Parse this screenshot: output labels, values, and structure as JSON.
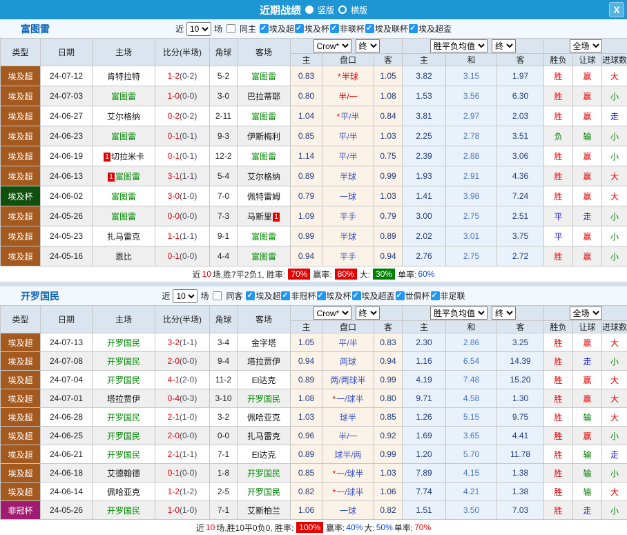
{
  "titlebar": {
    "title": "近期战绩",
    "vertical": "竖版",
    "horizontal": "横版",
    "close": "X"
  },
  "badges": {
    "red_card": "1"
  },
  "table_header": {
    "cols": [
      "类型",
      "日期",
      "主场",
      "比分(半场)",
      "角球",
      "客场"
    ],
    "sub": [
      "主",
      "盘口",
      "客",
      "主",
      "和",
      "客",
      "胜负",
      "让球",
      "进球数"
    ],
    "odds_source": "Crow*",
    "final": "终",
    "avg_label": "胜平负均值",
    "scope": "全场"
  },
  "colors": {
    "accent_blue": "#1E96D4",
    "league_super": "#A4591F",
    "league_cup": "#10500E",
    "league_afc": "#A21B72",
    "red": "#E60000",
    "green": "#008000",
    "blue": "#1414E6",
    "navy": "#1F3A7D",
    "mid_blue": "#4876CB"
  },
  "sections": [
    {
      "team": "富图雷",
      "filter": {
        "near": "近",
        "count": "10",
        "games": "场",
        "same_label": "同主",
        "same_checked": false,
        "leagues": [
          "埃及超",
          "埃及杯",
          "非联杯",
          "埃及联杯",
          "埃及超盃"
        ]
      },
      "rows": [
        {
          "type": "埃及超",
          "tc": "super",
          "date": "24-07-12",
          "home": {
            "n": "肯特拉特",
            "g": 0
          },
          "ft": "1-2",
          "ht": "(0-2)",
          "cr": "5-2",
          "away": {
            "n": "富图雷",
            "g": 1
          },
          "oh": "0.83",
          "hast": 1,
          "hcp": "半球",
          "hred": 1,
          "oa": "1.05",
          "ah": "3.82",
          "ad": "3.15",
          "aa": "1.97",
          "r1": [
            "胜",
            "r"
          ],
          "r2": [
            "赢",
            "r"
          ],
          "r3": [
            "大",
            "r"
          ]
        },
        {
          "type": "埃及超",
          "tc": "super",
          "date": "24-07-03",
          "home": {
            "n": "富图雷",
            "g": 1
          },
          "ft": "1-0",
          "ht": "(0-0)",
          "cr": "3-0",
          "away": {
            "n": "巴拉蒂耶",
            "g": 0
          },
          "oh": "0.80",
          "hast": 0,
          "hcp": "半/一",
          "hred": 1,
          "oa": "1.08",
          "ah": "1.53",
          "ad": "3.56",
          "aa": "6.30",
          "r1": [
            "胜",
            "r"
          ],
          "r2": [
            "赢",
            "r"
          ],
          "r3": [
            "小",
            "g"
          ]
        },
        {
          "type": "埃及超",
          "tc": "super",
          "date": "24-06-27",
          "home": {
            "n": "艾尔格纳",
            "g": 0
          },
          "ft": "0-2",
          "ht": "(0-2)",
          "cr": "2-11",
          "away": {
            "n": "富图雷",
            "g": 1
          },
          "oh": "1.04",
          "hast": 1,
          "hcp": "平/半",
          "hred": 0,
          "oa": "0.84",
          "ah": "3.81",
          "ad": "2.97",
          "aa": "2.03",
          "r1": [
            "胜",
            "r"
          ],
          "r2": [
            "赢",
            "r"
          ],
          "r3": [
            "走",
            "b"
          ]
        },
        {
          "type": "埃及超",
          "tc": "super",
          "date": "24-06-23",
          "home": {
            "n": "富图雷",
            "g": 1
          },
          "ft": "0-1",
          "ht": "(0-1)",
          "cr": "9-3",
          "away": {
            "n": "伊斯梅利",
            "g": 0
          },
          "oh": "0.85",
          "hast": 0,
          "hcp": "平/半",
          "hred": 0,
          "oa": "1.03",
          "ah": "2.25",
          "ad": "2.78",
          "aa": "3.51",
          "r1": [
            "负",
            "g"
          ],
          "r2": [
            "输",
            "g"
          ],
          "r3": [
            "小",
            "g"
          ]
        },
        {
          "type": "埃及超",
          "tc": "super",
          "date": "24-06-19",
          "home": {
            "n": "切拉米卡",
            "g": 0,
            "rb": 1
          },
          "ft": "0-1",
          "ht": "(0-1)",
          "cr": "12-2",
          "away": {
            "n": "富图雷",
            "g": 1
          },
          "oh": "1.14",
          "hast": 0,
          "hcp": "平/半",
          "hred": 0,
          "oa": "0.75",
          "ah": "2.39",
          "ad": "2.88",
          "aa": "3.06",
          "r1": [
            "胜",
            "r"
          ],
          "r2": [
            "赢",
            "r"
          ],
          "r3": [
            "小",
            "g"
          ]
        },
        {
          "type": "埃及超",
          "tc": "super",
          "date": "24-06-13",
          "home": {
            "n": "富图雷",
            "g": 1,
            "rb": 1
          },
          "ft": "3-1",
          "ht": "(1-1)",
          "cr": "5-4",
          "away": {
            "n": "艾尔格纳",
            "g": 0
          },
          "oh": "0.89",
          "hast": 0,
          "hcp": "半球",
          "hred": 0,
          "oa": "0.99",
          "ah": "1.93",
          "ad": "2.91",
          "aa": "4.36",
          "r1": [
            "胜",
            "r"
          ],
          "r2": [
            "赢",
            "r"
          ],
          "r3": [
            "大",
            "r"
          ]
        },
        {
          "type": "埃及杯",
          "tc": "cup",
          "date": "24-06-02",
          "home": {
            "n": "富图雷",
            "g": 1
          },
          "ft": "3-0",
          "ht": "(1-0)",
          "cr": "7-0",
          "away": {
            "n": "佩特雷姆",
            "g": 0
          },
          "oh": "0.79",
          "hast": 0,
          "hcp": "一球",
          "hred": 0,
          "oa": "1.03",
          "ah": "1.41",
          "ad": "3.98",
          "aa": "7.24",
          "r1": [
            "胜",
            "r"
          ],
          "r2": [
            "赢",
            "r"
          ],
          "r3": [
            "大",
            "r"
          ]
        },
        {
          "type": "埃及超",
          "tc": "super",
          "date": "24-05-26",
          "home": {
            "n": "富图雷",
            "g": 1
          },
          "ft": "0-0",
          "ht": "(0-0)",
          "cr": "7-3",
          "away": {
            "n": "马斯里",
            "g": 0,
            "ra": 1
          },
          "oh": "1.09",
          "hast": 0,
          "hcp": "平手",
          "hred": 0,
          "oa": "0.79",
          "ah": "3.00",
          "ad": "2.75",
          "aa": "2.51",
          "r1": [
            "平",
            "b"
          ],
          "r2": [
            "走",
            "b"
          ],
          "r3": [
            "小",
            "g"
          ]
        },
        {
          "type": "埃及超",
          "tc": "super",
          "date": "24-05-23",
          "home": {
            "n": "扎马雷克",
            "g": 0
          },
          "ft": "1-1",
          "ht": "(1-1)",
          "cr": "9-1",
          "away": {
            "n": "富图雷",
            "g": 1
          },
          "oh": "0.99",
          "hast": 0,
          "hcp": "半球",
          "hred": 0,
          "oa": "0.89",
          "ah": "2.02",
          "ad": "3.01",
          "aa": "3.75",
          "r1": [
            "平",
            "b"
          ],
          "r2": [
            "赢",
            "r"
          ],
          "r3": [
            "小",
            "g"
          ]
        },
        {
          "type": "埃及超",
          "tc": "super",
          "date": "24-05-16",
          "home": {
            "n": "恩比",
            "g": 0
          },
          "ft": "0-1",
          "ht": "(0-0)",
          "cr": "4-4",
          "away": {
            "n": "富图雷",
            "g": 1
          },
          "oh": "0.94",
          "hast": 0,
          "hcp": "平手",
          "hred": 0,
          "oa": "0.94",
          "ah": "2.76",
          "ad": "2.75",
          "aa": "2.72",
          "r1": [
            "胜",
            "r"
          ],
          "r2": [
            "赢",
            "r"
          ],
          "r3": [
            "小",
            "g"
          ]
        }
      ],
      "summary": [
        [
          "近",
          "k"
        ],
        [
          "10",
          "r"
        ],
        [
          "场,胜7平2负1, 胜率:",
          "k"
        ],
        [
          "70%",
          "R"
        ],
        [
          "赢率:",
          "k"
        ],
        [
          "80%",
          "R"
        ],
        [
          "大:",
          "k"
        ],
        [
          "30%",
          "G"
        ],
        [
          "单率:",
          "k"
        ],
        [
          "60%",
          "b"
        ]
      ]
    },
    {
      "team": "开罗国民",
      "filter": {
        "near": "近",
        "count": "10",
        "games": "场",
        "same_label": "同客",
        "same_checked": false,
        "leagues": [
          "埃及超",
          "非冠杯",
          "埃及杯",
          "埃及超盃",
          "世俱杯",
          "非足联"
        ]
      },
      "rows": [
        {
          "type": "埃及超",
          "tc": "super",
          "date": "24-07-13",
          "home": {
            "n": "开罗国民",
            "g": 1
          },
          "ft": "3-2",
          "ht": "(1-1)",
          "cr": "3-4",
          "away": {
            "n": "金字塔",
            "g": 0
          },
          "oh": "1.05",
          "hast": 0,
          "hcp": "平/半",
          "hred": 0,
          "oa": "0.83",
          "ah": "2.30",
          "ad": "2.86",
          "aa": "3.25",
          "r1": [
            "胜",
            "r"
          ],
          "r2": [
            "赢",
            "r"
          ],
          "r3": [
            "大",
            "r"
          ]
        },
        {
          "type": "埃及超",
          "tc": "super",
          "date": "24-07-08",
          "home": {
            "n": "开罗国民",
            "g": 1
          },
          "ft": "2-0",
          "ht": "(0-0)",
          "cr": "9-4",
          "away": {
            "n": "塔拉贾伊",
            "g": 0
          },
          "oh": "0.94",
          "hast": 0,
          "hcp": "两球",
          "hred": 0,
          "oa": "0.94",
          "ah": "1.16",
          "ad": "6.54",
          "aa": "14.39",
          "r1": [
            "胜",
            "r"
          ],
          "r2": [
            "走",
            "b"
          ],
          "r3": [
            "小",
            "g"
          ]
        },
        {
          "type": "埃及超",
          "tc": "super",
          "date": "24-07-04",
          "home": {
            "n": "开罗国民",
            "g": 1
          },
          "ft": "4-1",
          "ht": "(2-0)",
          "cr": "11-2",
          "away": {
            "n": "El达克",
            "g": 0
          },
          "oh": "0.89",
          "hast": 0,
          "hcp": "两/两球半",
          "hred": 0,
          "oa": "0.99",
          "ah": "4.19",
          "ad": "7.48",
          "aa": "15.20",
          "r1": [
            "胜",
            "r"
          ],
          "r2": [
            "赢",
            "r"
          ],
          "r3": [
            "大",
            "r"
          ]
        },
        {
          "type": "埃及超",
          "tc": "super",
          "date": "24-07-01",
          "home": {
            "n": "塔拉贾伊",
            "g": 0
          },
          "ft": "0-4",
          "ht": "(0-3)",
          "cr": "3-10",
          "away": {
            "n": "开罗国民",
            "g": 1
          },
          "oh": "1.08",
          "hast": 1,
          "hcp": "一/球半",
          "hred": 0,
          "oa": "0.80",
          "ah": "9.71",
          "ad": "4.58",
          "aa": "1.30",
          "r1": [
            "胜",
            "r"
          ],
          "r2": [
            "赢",
            "r"
          ],
          "r3": [
            "大",
            "r"
          ]
        },
        {
          "type": "埃及超",
          "tc": "super",
          "date": "24-06-28",
          "home": {
            "n": "开罗国民",
            "g": 1
          },
          "ft": "2-1",
          "ht": "(1-0)",
          "cr": "3-2",
          "away": {
            "n": "佩哈亚克",
            "g": 0
          },
          "oh": "1.03",
          "hast": 0,
          "hcp": "球半",
          "hred": 0,
          "oa": "0.85",
          "ah": "1.26",
          "ad": "5.15",
          "aa": "9.75",
          "r1": [
            "胜",
            "r"
          ],
          "r2": [
            "输",
            "g"
          ],
          "r3": [
            "大",
            "r"
          ]
        },
        {
          "type": "埃及超",
          "tc": "super",
          "date": "24-06-25",
          "home": {
            "n": "开罗国民",
            "g": 1
          },
          "ft": "2-0",
          "ht": "(0-0)",
          "cr": "0-0",
          "away": {
            "n": "扎马雷克",
            "g": 0
          },
          "oh": "0.96",
          "hast": 0,
          "hcp": "半/一",
          "hred": 0,
          "oa": "0.92",
          "ah": "1.69",
          "ad": "3.65",
          "aa": "4.41",
          "r1": [
            "胜",
            "r"
          ],
          "r2": [
            "赢",
            "r"
          ],
          "r3": [
            "小",
            "g"
          ]
        },
        {
          "type": "埃及超",
          "tc": "super",
          "date": "24-06-21",
          "home": {
            "n": "开罗国民",
            "g": 1
          },
          "ft": "2-1",
          "ht": "(1-1)",
          "cr": "7-1",
          "away": {
            "n": "El达克",
            "g": 0
          },
          "oh": "0.89",
          "hast": 0,
          "hcp": "球半/两",
          "hred": 0,
          "oa": "0.99",
          "ah": "1.20",
          "ad": "5.70",
          "aa": "11.78",
          "r1": [
            "胜",
            "r"
          ],
          "r2": [
            "输",
            "g"
          ],
          "r3": [
            "走",
            "b"
          ]
        },
        {
          "type": "埃及超",
          "tc": "super",
          "date": "24-06-18",
          "home": {
            "n": "艾德翰德",
            "g": 0
          },
          "ft": "0-1",
          "ht": "(0-0)",
          "cr": "1-8",
          "away": {
            "n": "开罗国民",
            "g": 1
          },
          "oh": "0.85",
          "hast": 1,
          "hcp": "一/球半",
          "hred": 0,
          "oa": "1.03",
          "ah": "7.89",
          "ad": "4.15",
          "aa": "1.38",
          "r1": [
            "胜",
            "r"
          ],
          "r2": [
            "输",
            "g"
          ],
          "r3": [
            "小",
            "g"
          ]
        },
        {
          "type": "埃及超",
          "tc": "super",
          "date": "24-06-14",
          "home": {
            "n": "佩哈亚克",
            "g": 0
          },
          "ft": "1-2",
          "ht": "(1-2)",
          "cr": "2-5",
          "away": {
            "n": "开罗国民",
            "g": 1
          },
          "oh": "0.82",
          "hast": 1,
          "hcp": "一/球半",
          "hred": 0,
          "oa": "1.06",
          "ah": "7.74",
          "ad": "4.21",
          "aa": "1.38",
          "r1": [
            "胜",
            "r"
          ],
          "r2": [
            "输",
            "g"
          ],
          "r3": [
            "大",
            "r"
          ]
        },
        {
          "type": "非冠杯",
          "tc": "afc",
          "date": "24-05-26",
          "home": {
            "n": "开罗国民",
            "g": 1
          },
          "ft": "1-0",
          "ht": "(1-0)",
          "cr": "7-1",
          "away": {
            "n": "艾斯柏兰",
            "g": 0
          },
          "oh": "1.06",
          "hast": 0,
          "hcp": "一球",
          "hred": 0,
          "oa": "0.82",
          "ah": "1.51",
          "ad": "3.50",
          "aa": "7.03",
          "r1": [
            "胜",
            "r"
          ],
          "r2": [
            "走",
            "b"
          ],
          "r3": [
            "小",
            "g"
          ]
        }
      ],
      "summary": [
        [
          "近",
          "k"
        ],
        [
          "10",
          "r"
        ],
        [
          "场,胜10平0负0, 胜率:",
          "k"
        ],
        [
          "100%",
          "R"
        ],
        [
          "赢率:",
          "k"
        ],
        [
          "40%",
          "b"
        ],
        [
          "大:",
          "k"
        ],
        [
          "50%",
          "b"
        ],
        [
          "单率:",
          "k"
        ],
        [
          "70%",
          "r"
        ]
      ]
    }
  ]
}
